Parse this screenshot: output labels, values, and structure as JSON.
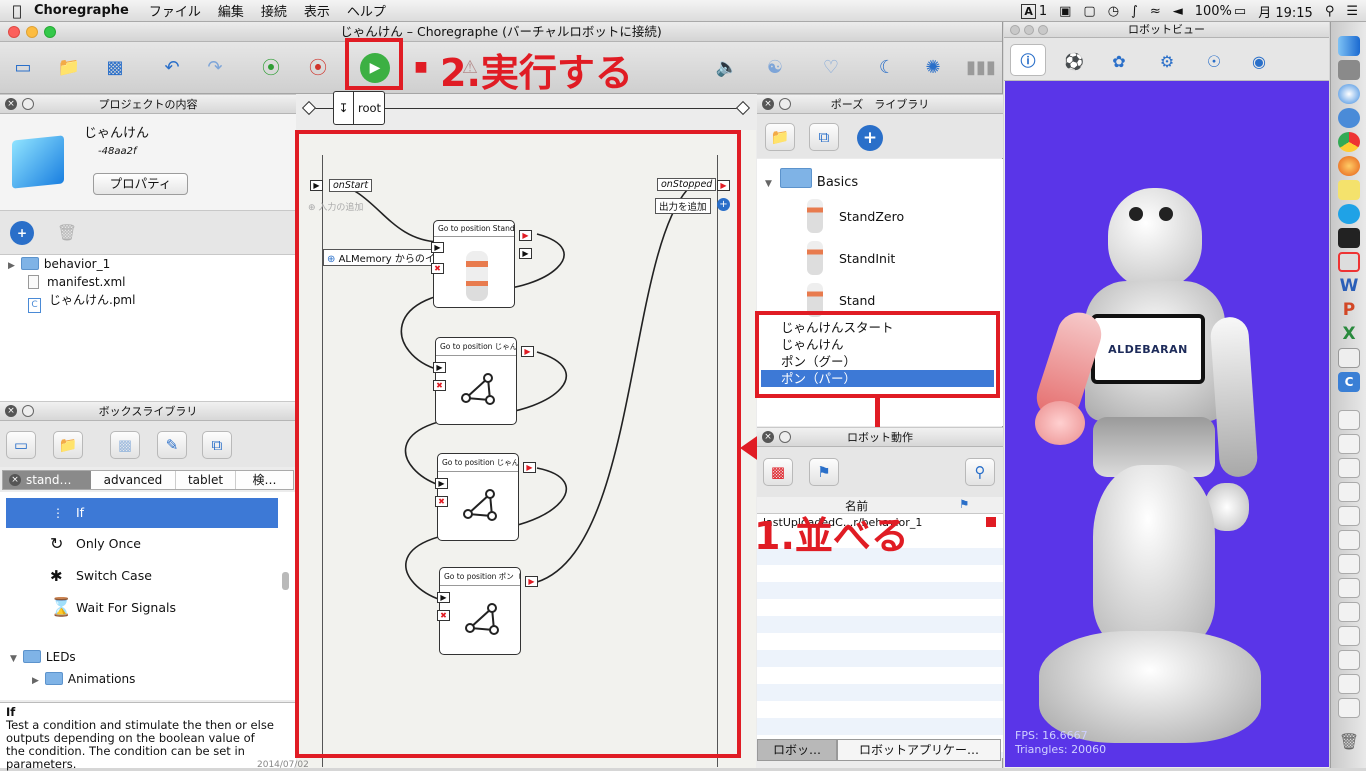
{
  "menubar": {
    "app_name": "Choregraphe",
    "menus": [
      "ファイル",
      "編集",
      "接続",
      "表示",
      "ヘルプ"
    ],
    "status": {
      "input_badge": "1",
      "battery": "100%",
      "clock": "月 19:15"
    }
  },
  "window": {
    "title": "じゃんけん – Choregraphe (バーチャルロボットに接続)"
  },
  "annotations": {
    "step2": "2.実行する",
    "step1": "1.並べる"
  },
  "project_panel": {
    "header": "プロジェクトの内容",
    "project_name": "じゃんけん",
    "project_id": "-48aa2f",
    "properties_button": "プロパティ",
    "files": [
      {
        "name": "behavior_1",
        "type": "folder"
      },
      {
        "name": "manifest.xml",
        "type": "file"
      },
      {
        "name": "じゃんけん.pml",
        "type": "pml"
      }
    ]
  },
  "box_library": {
    "header": "ボックスライブラリ",
    "tabs": [
      "stand…",
      "advanced",
      "tablet",
      "検…"
    ],
    "items": [
      {
        "label": "If",
        "selected": true
      },
      {
        "label": "Only Once",
        "selected": false
      },
      {
        "label": "Switch Case",
        "selected": false
      },
      {
        "label": "Wait For Signals",
        "selected": false
      }
    ],
    "folders": [
      "LEDs",
      "Animations"
    ],
    "description_title": "If",
    "description": "Test a condition and stimulate the then or else outputs depending on the boolean value of the condition. The condition can be set in parameters."
  },
  "flow": {
    "breadcrumb": "root",
    "on_start": "onStart",
    "add_input": "入力の追加",
    "almemory": "ALMemory からのイベントの追加",
    "on_stopped": "onStopped",
    "add_output": "出力を追加",
    "boxes": [
      "Go to position Stand",
      "Go to position じゃんけ",
      "Go to position じゃんけ",
      "Go to position ポン（パ"
    ]
  },
  "pose_library": {
    "header": "ポーズ　ライブラリ",
    "folder": "Basics",
    "poses": [
      "StandZero",
      "StandInit",
      "Stand"
    ],
    "list": [
      "じゃんけんスタート",
      "じゃんけん",
      "ポン（グー）",
      "ポン（パー）"
    ],
    "selected_index": 3
  },
  "robot_actions": {
    "header": "ロボット動作",
    "column_name": "名前",
    "row": "lastUploadedC...r/behavior_1",
    "tabs": [
      "ロボッ…",
      "ロボットアプリケー…"
    ]
  },
  "robot_view": {
    "header": "ロボットビュー",
    "logo": "ALDEBARAN",
    "fps": "FPS: 16.6667",
    "triangles": "Triangles: 20060"
  },
  "footer_date": "2014/07/02",
  "colors": {
    "accent": "#2a6fc9",
    "annotation": "#e01c24",
    "robot_bg": "#5a35e8",
    "selection": "#3d79d6"
  }
}
